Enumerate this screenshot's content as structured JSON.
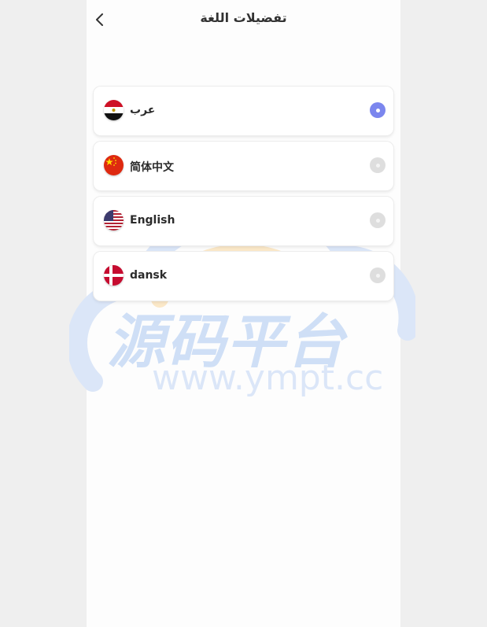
{
  "header": {
    "title": "تفضيلات اللغة",
    "back_icon": "chevron-left-icon"
  },
  "languages": [
    {
      "label": "عرب",
      "flag": "egypt-flag-icon",
      "selected": true
    },
    {
      "label": "简体中文",
      "flag": "china-flag-icon",
      "selected": false
    },
    {
      "label": "English",
      "flag": "usa-flag-icon",
      "selected": false
    },
    {
      "label": "dansk",
      "flag": "denmark-flag-icon",
      "selected": false
    }
  ],
  "watermark": {
    "text_cn": "源码平台",
    "url": "www.ympt.cc"
  },
  "colors": {
    "accent": "#7b86ee",
    "radio_unselected": "#dedede",
    "background": "#efefef",
    "panel": "#fdfdfd"
  }
}
